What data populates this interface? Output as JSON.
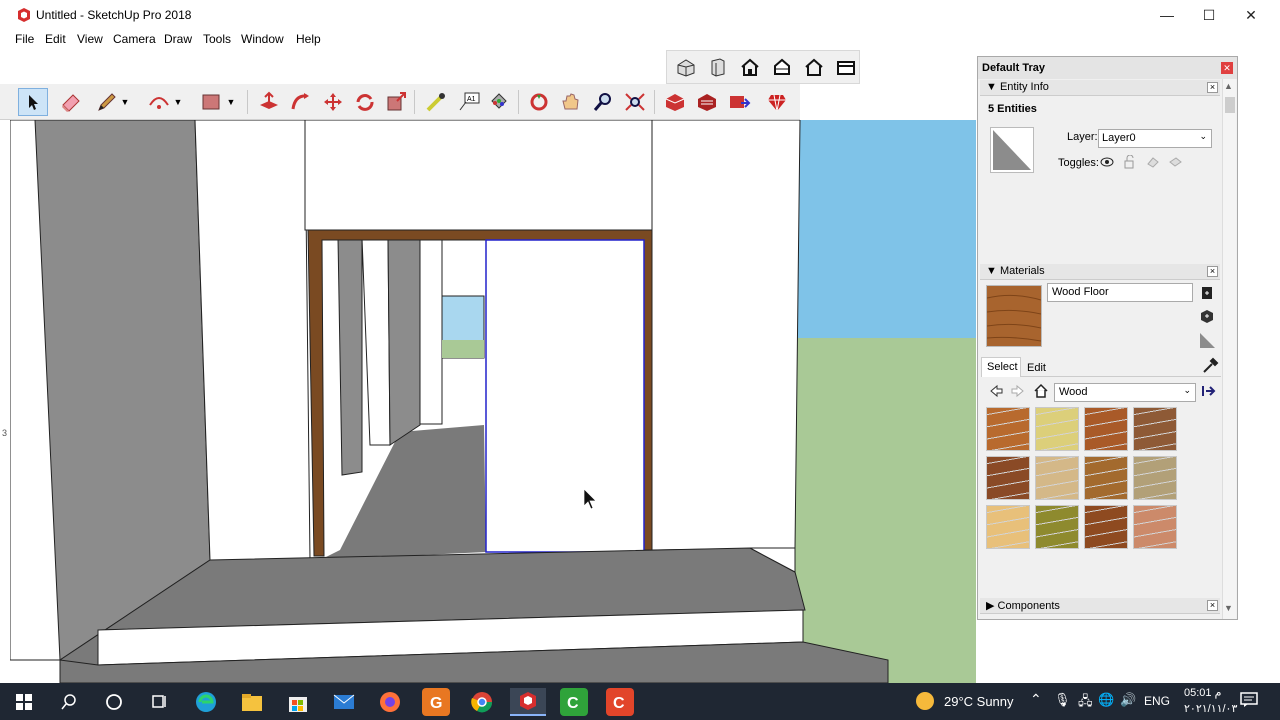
{
  "window": {
    "title": "Untitled - SketchUp Pro 2018",
    "minimize": "—",
    "maximize": "☐",
    "close": "✕"
  },
  "menu": [
    "File",
    "Edit",
    "View",
    "Camera",
    "Draw",
    "Tools",
    "Window",
    "Help"
  ],
  "tray": {
    "title": "Default Tray",
    "entity_info": {
      "header": "Entity Info",
      "count": "5 Entities",
      "layer_label": "Layer:",
      "layer_value": "Layer0",
      "toggles_label": "Toggles:"
    },
    "materials": {
      "header": "Materials",
      "name": "Wood Floor",
      "tab_select": "Select",
      "tab_edit": "Edit",
      "library": "Wood",
      "swatches": [
        "#b86a2e",
        "#dccf7a",
        "#a95a28",
        "#8e5a36",
        "#8a4a26",
        "#d4b888",
        "#a36a2e",
        "#b2a078",
        "#e8c07a",
        "#8e8a2e",
        "#8e4a20",
        "#cc8a6a"
      ]
    },
    "components": {
      "header": "Components"
    }
  },
  "taskbar": {
    "weather": "29°C  Sunny",
    "lang": "ENG",
    "time": "05:01 م",
    "date": "٢٠٢١/١١/٠٣"
  }
}
